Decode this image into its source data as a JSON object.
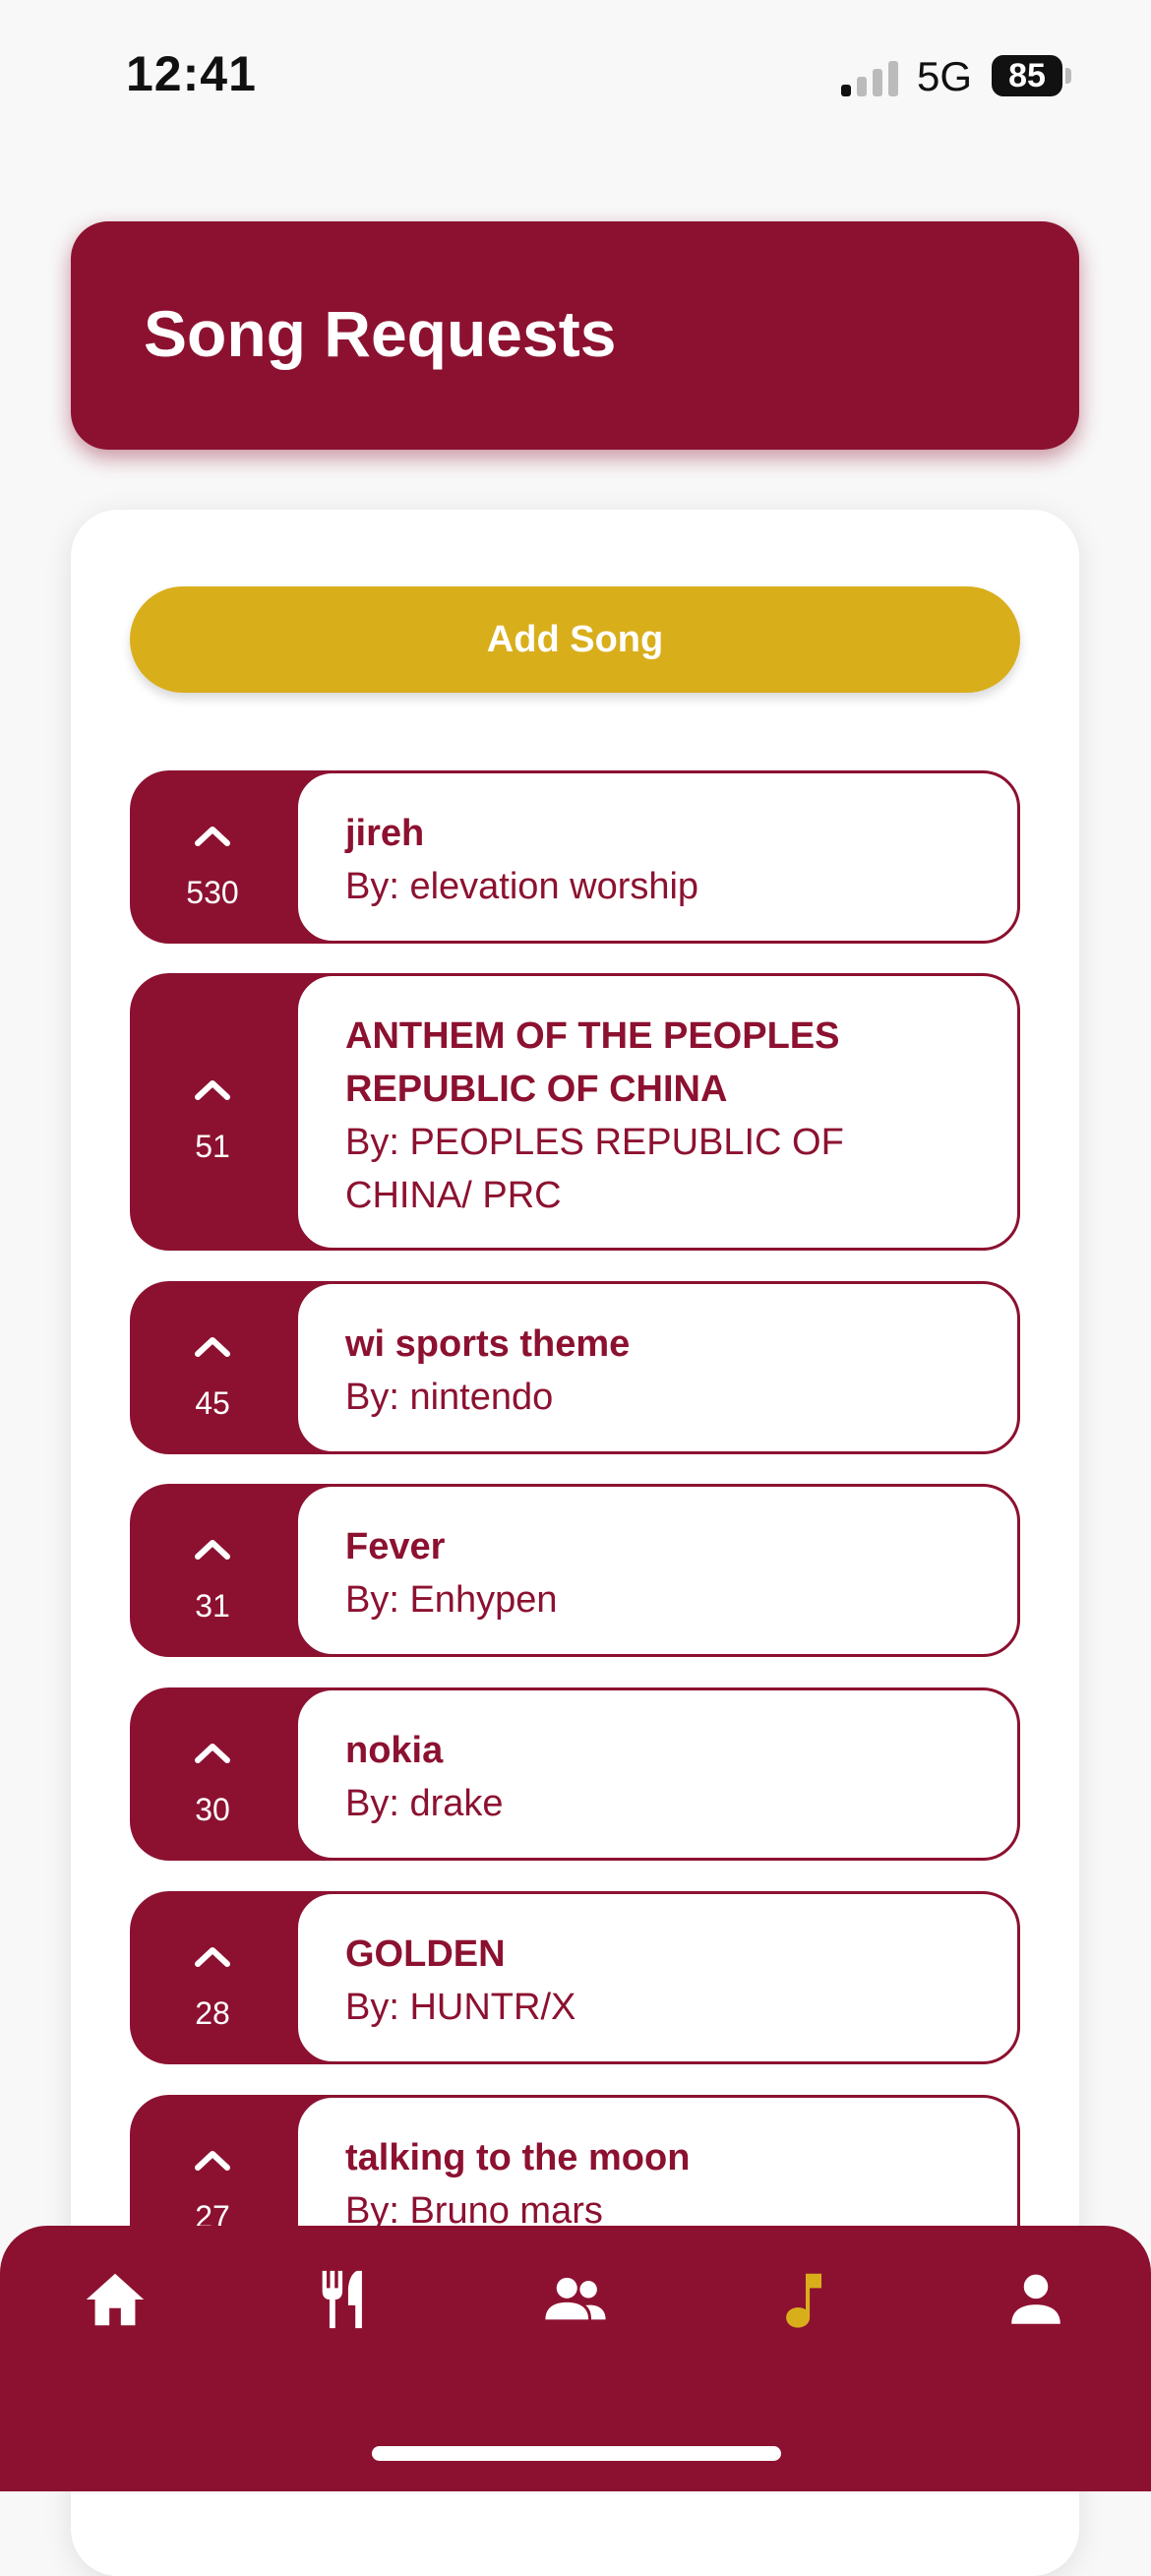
{
  "status_bar": {
    "time": "12:41",
    "network": "5G",
    "battery": "85"
  },
  "header": {
    "title": "Song Requests"
  },
  "actions": {
    "add_song": "Add Song"
  },
  "songs": [
    {
      "title": "jireh",
      "artist": "By: elevation worship",
      "votes": "530"
    },
    {
      "title": "ANTHEM OF THE PEOPLES REPUBLIC OF CHINA",
      "artist": "By: PEOPLES REPUBLIC OF CHINA/ PRC",
      "votes": "51"
    },
    {
      "title": "wi sports theme",
      "artist": "By: nintendo",
      "votes": "45"
    },
    {
      "title": "Fever",
      "artist": "By: Enhypen",
      "votes": "31"
    },
    {
      "title": "nokia",
      "artist": "By: drake",
      "votes": "30"
    },
    {
      "title": "GOLDEN",
      "artist": "By: HUNTR/X",
      "votes": "28"
    },
    {
      "title": "talking to the moon",
      "artist": "By: Bruno mars",
      "votes": "27"
    }
  ],
  "tabbar": {
    "items": [
      {
        "icon": "home-icon",
        "active": false
      },
      {
        "icon": "dining-icon",
        "active": false
      },
      {
        "icon": "people-icon",
        "active": false
      },
      {
        "icon": "music-note-icon",
        "active": true
      },
      {
        "icon": "profile-icon",
        "active": false
      }
    ]
  },
  "colors": {
    "primary": "#8c1130",
    "accent": "#d9ae1b",
    "background": "#f8f8f8"
  }
}
